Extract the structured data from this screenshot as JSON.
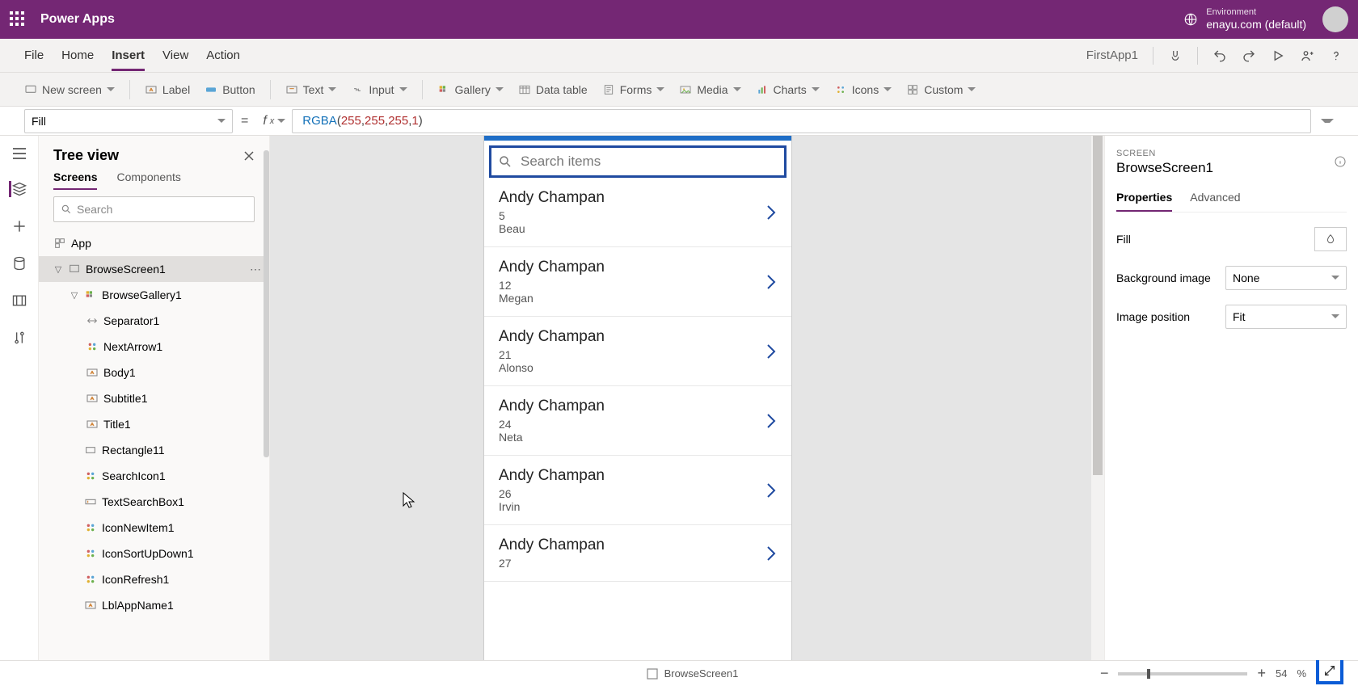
{
  "header": {
    "app_title": "Power Apps",
    "env_label": "Environment",
    "env_name": "enayu.com (default)"
  },
  "menubar": {
    "items": [
      "File",
      "Home",
      "Insert",
      "View",
      "Action"
    ],
    "active": "Insert",
    "app_name": "FirstApp1"
  },
  "ribbon": {
    "new_screen": "New screen",
    "label": "Label",
    "button": "Button",
    "text": "Text",
    "input": "Input",
    "gallery": "Gallery",
    "data_table": "Data table",
    "forms": "Forms",
    "media": "Media",
    "charts": "Charts",
    "icons": "Icons",
    "custom": "Custom"
  },
  "formula": {
    "property": "Fill",
    "fn": "RGBA",
    "a1": "255",
    "a2": "255",
    "a3": "255",
    "a4": "1"
  },
  "tree": {
    "title": "Tree view",
    "tabs": {
      "screens": "Screens",
      "components": "Components"
    },
    "search_placeholder": "Search",
    "nodes": [
      {
        "depth": 0,
        "icon": "app",
        "label": "App"
      },
      {
        "depth": 1,
        "icon": "screen",
        "label": "BrowseScreen1",
        "selected": true,
        "twisty": "down",
        "more": true
      },
      {
        "depth": 2,
        "icon": "gallery",
        "label": "BrowseGallery1",
        "twisty": "down"
      },
      {
        "depth": 3,
        "icon": "sep",
        "label": "Separator1"
      },
      {
        "depth": 3,
        "icon": "icon",
        "label": "NextArrow1"
      },
      {
        "depth": 3,
        "icon": "textlbl",
        "label": "Body1"
      },
      {
        "depth": 3,
        "icon": "textlbl",
        "label": "Subtitle1"
      },
      {
        "depth": 3,
        "icon": "textlbl",
        "label": "Title1"
      },
      {
        "depth": 2,
        "icon": "rect",
        "label": "Rectangle11"
      },
      {
        "depth": 2,
        "icon": "icon",
        "label": "SearchIcon1"
      },
      {
        "depth": 2,
        "icon": "input",
        "label": "TextSearchBox1"
      },
      {
        "depth": 2,
        "icon": "icon",
        "label": "IconNewItem1"
      },
      {
        "depth": 2,
        "icon": "icon",
        "label": "IconSortUpDown1"
      },
      {
        "depth": 2,
        "icon": "icon",
        "label": "IconRefresh1"
      },
      {
        "depth": 2,
        "icon": "textlbl",
        "label": "LblAppName1"
      }
    ]
  },
  "canvas": {
    "search_placeholder": "Search items",
    "items": [
      {
        "title": "Andy Champan",
        "sub": "5",
        "body": "Beau"
      },
      {
        "title": "Andy Champan",
        "sub": "12",
        "body": "Megan"
      },
      {
        "title": "Andy Champan",
        "sub": "21",
        "body": "Alonso"
      },
      {
        "title": "Andy Champan",
        "sub": "24",
        "body": "Neta"
      },
      {
        "title": "Andy Champan",
        "sub": "26",
        "body": "Irvin"
      },
      {
        "title": "Andy Champan",
        "sub": "27",
        "body": ""
      }
    ]
  },
  "props": {
    "eyebrow": "SCREEN",
    "title": "BrowseScreen1",
    "tabs": {
      "properties": "Properties",
      "advanced": "Advanced"
    },
    "fill_label": "Fill",
    "bgimg_label": "Background image",
    "bgimg_value": "None",
    "imgpos_label": "Image position",
    "imgpos_value": "Fit"
  },
  "status": {
    "screen": "BrowseScreen1",
    "zoom": "54",
    "pct": "%"
  }
}
